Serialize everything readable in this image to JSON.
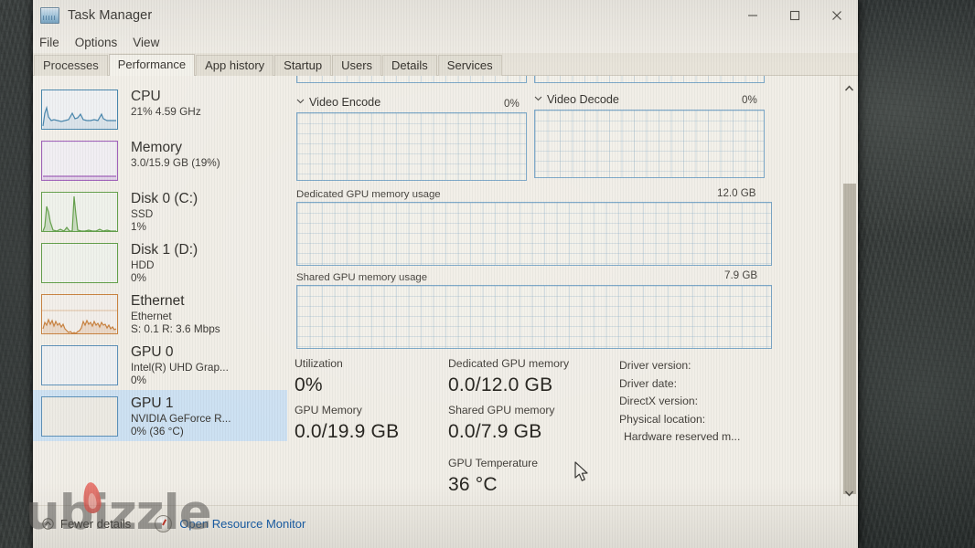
{
  "window": {
    "title": "Task Manager",
    "icon": "task-manager-icon",
    "controls": {
      "minimize": "Minimize",
      "maximize": "Maximize",
      "close": "Close"
    }
  },
  "menu": {
    "items": [
      "File",
      "Options",
      "View"
    ]
  },
  "tabs": {
    "items": [
      {
        "label": "Processes",
        "active": false
      },
      {
        "label": "Performance",
        "active": true
      },
      {
        "label": "App history",
        "active": false
      },
      {
        "label": "Startup",
        "active": false
      },
      {
        "label": "Users",
        "active": false
      },
      {
        "label": "Details",
        "active": false
      },
      {
        "label": "Services",
        "active": false
      }
    ]
  },
  "sidebar": {
    "items": [
      {
        "name": "CPU",
        "lines": [
          "21%  4.59 GHz"
        ],
        "color": "#3d7fa8",
        "selected": false,
        "graph": "line-active"
      },
      {
        "name": "Memory",
        "lines": [
          "3.0/15.9 GB (19%)"
        ],
        "color": "#9b59b6",
        "selected": false,
        "graph": "flat-low"
      },
      {
        "name": "Disk 0 (C:)",
        "lines": [
          "SSD",
          "1%"
        ],
        "color": "#5d9c43",
        "selected": false,
        "graph": "spikes"
      },
      {
        "name": "Disk 1 (D:)",
        "lines": [
          "HDD",
          "0%"
        ],
        "color": "#5d9c43",
        "selected": false,
        "graph": "empty"
      },
      {
        "name": "Ethernet",
        "lines": [
          "Ethernet",
          "S: 0.1 R: 3.6 Mbps"
        ],
        "color": "#c87f3a",
        "selected": false,
        "graph": "network"
      },
      {
        "name": "GPU 0",
        "lines": [
          "Intel(R) UHD Grap...",
          "0%"
        ],
        "color": "#5a8fb8",
        "selected": false,
        "graph": "empty"
      },
      {
        "name": "GPU 1",
        "lines": [
          "NVIDIA GeForce R...",
          "0%  (36 °C)"
        ],
        "color": "#5a8fb8",
        "selected": true,
        "graph": "empty"
      }
    ]
  },
  "detail": {
    "video_encode": {
      "label": "Video Encode",
      "value": "0%"
    },
    "video_decode": {
      "label": "Video Decode",
      "value": "0%"
    },
    "dedicated_memory_graph": {
      "label": "Dedicated GPU memory usage",
      "max": "12.0 GB"
    },
    "shared_memory_graph": {
      "label": "Shared GPU memory usage",
      "max": "7.9 GB"
    },
    "stats": {
      "utilization_label": "Utilization",
      "utilization_value": "0%",
      "gpu_memory_label": "GPU Memory",
      "gpu_memory_value": "0.0/19.9 GB",
      "dedicated_label": "Dedicated GPU memory",
      "dedicated_value": "0.0/12.0 GB",
      "shared_label": "Shared GPU memory",
      "shared_value": "0.0/7.9 GB",
      "temperature_label": "GPU Temperature",
      "temperature_value": "36 °C"
    },
    "info": [
      "Driver version:",
      "Driver date:",
      "DirectX version:",
      "Physical location:",
      "Hardware reserved m..."
    ]
  },
  "statusbar": {
    "fewer_details": "Fewer details",
    "resource_monitor": "Open Resource Monitor"
  },
  "watermark": {
    "text": "ubizzle"
  },
  "colors": {
    "accent_blue": "#7ba7c7",
    "selection": "#cde1f2",
    "link": "#1a5fa8",
    "window_bg": "#efece4"
  }
}
